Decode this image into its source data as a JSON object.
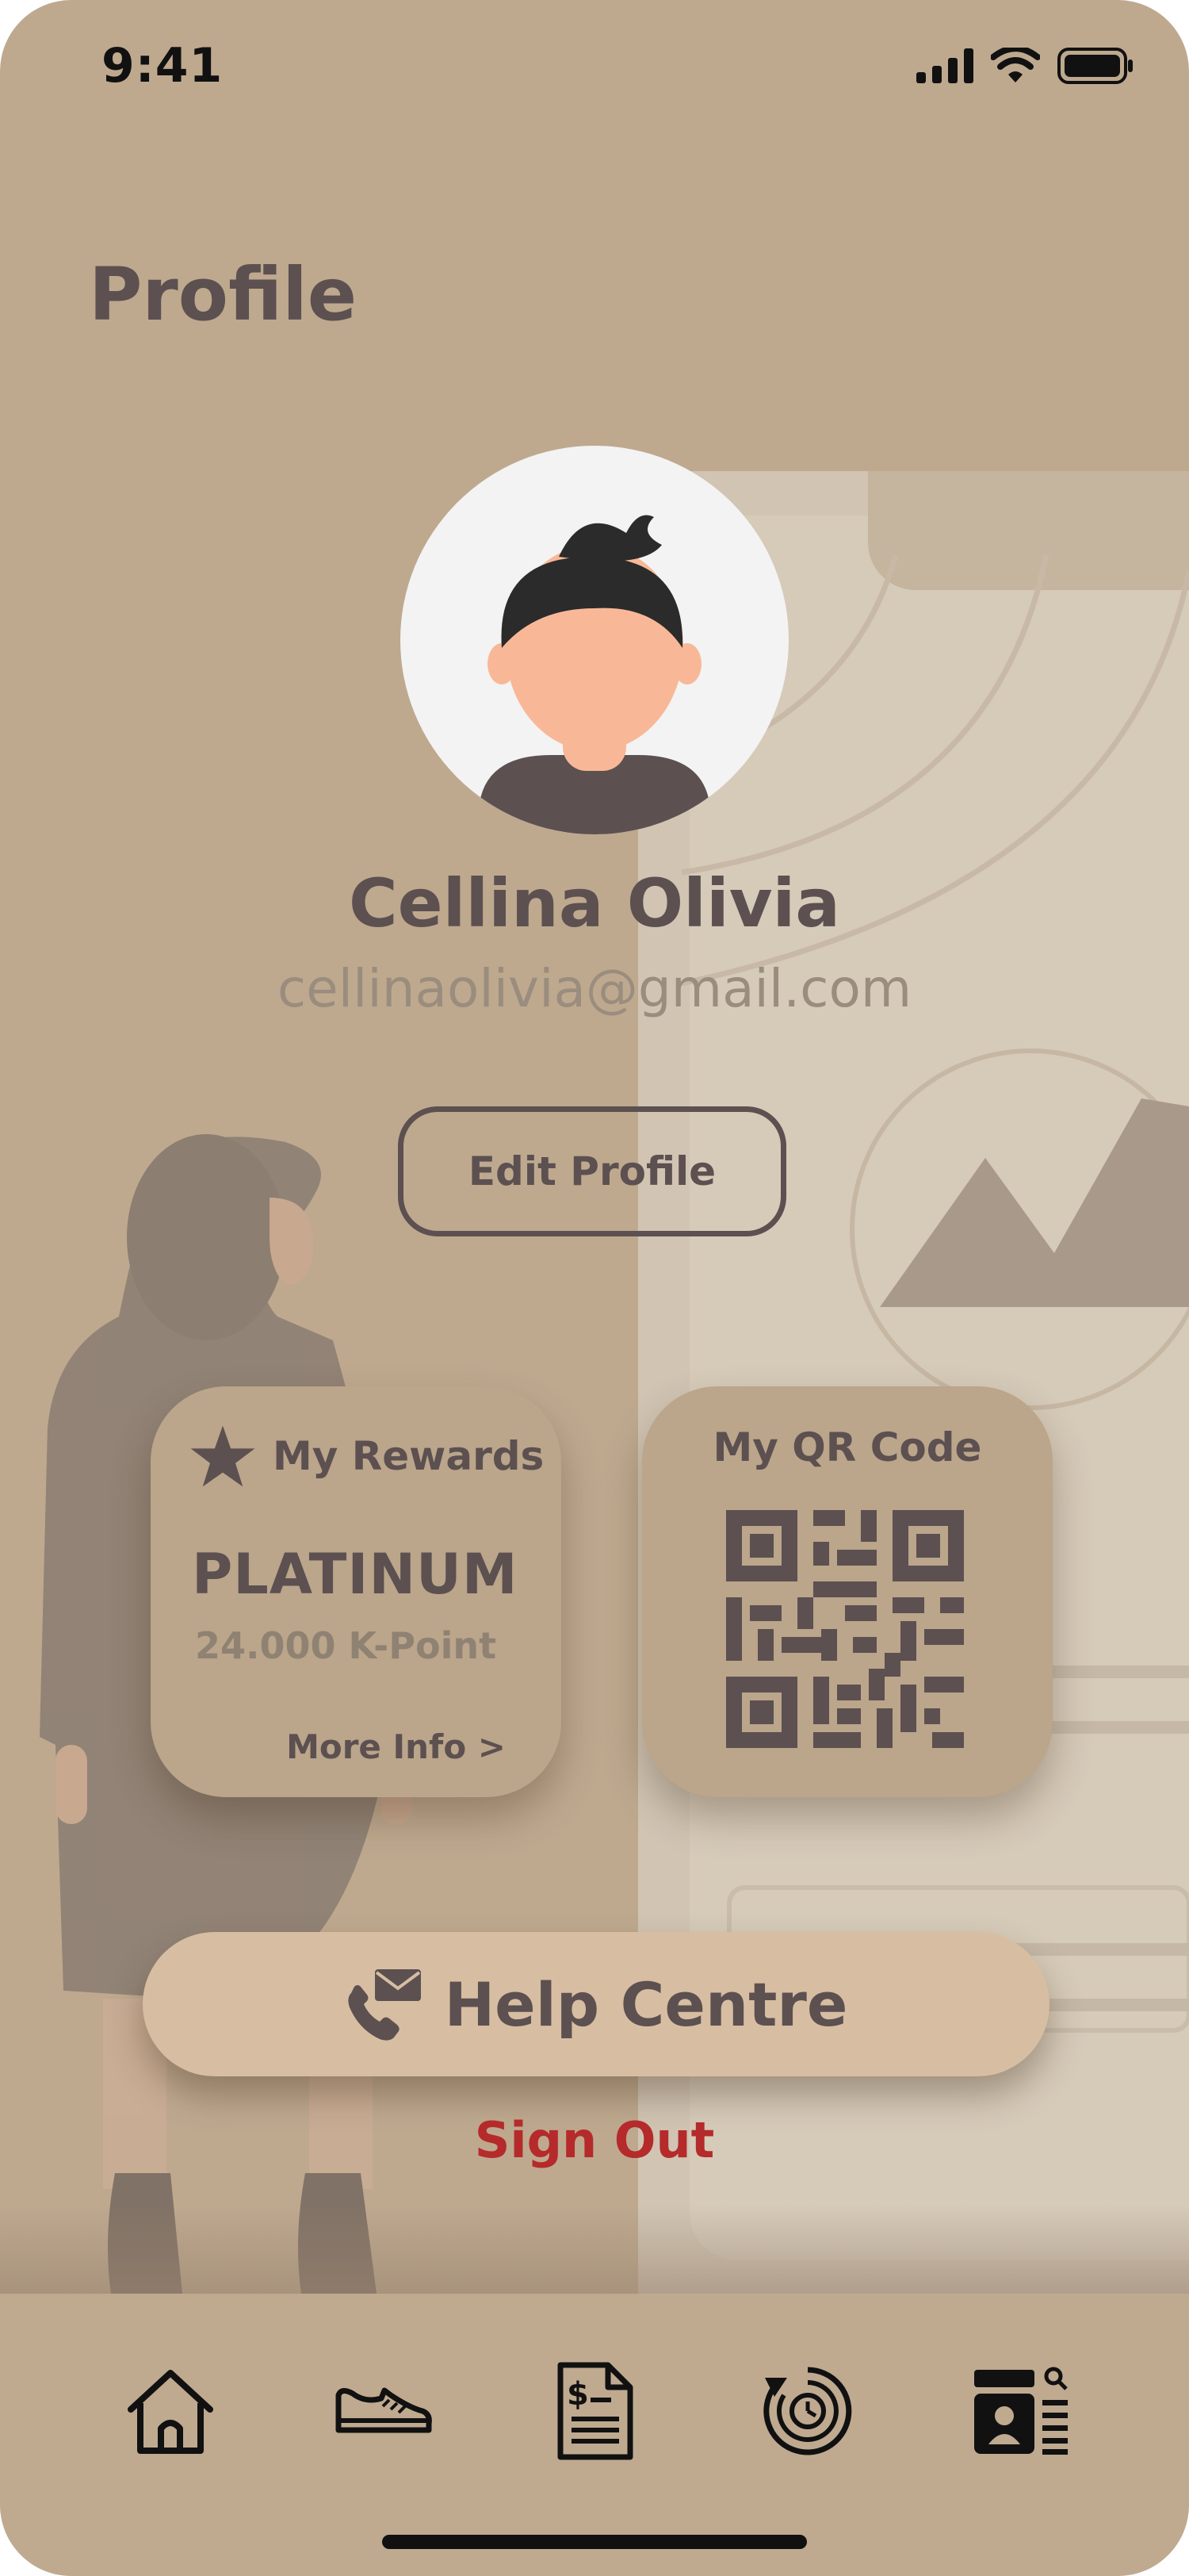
{
  "status_bar": {
    "time": "9:41"
  },
  "page": {
    "title": "Profile"
  },
  "profile": {
    "name": "Cellina Olivia",
    "email": "cellinaolivia@gmail.com",
    "edit_label": "Edit Profile"
  },
  "rewards_card": {
    "title": "My Rewards",
    "tier": "PLATINUM",
    "points": "24.000 K-Point",
    "more_label": "More Info >"
  },
  "qr_card": {
    "title": "My QR Code"
  },
  "help": {
    "label": "Help Centre"
  },
  "signout": {
    "label": "Sign Out"
  },
  "tabbar": {
    "items": [
      "home-icon",
      "shoe-icon",
      "invoice-icon",
      "history-icon",
      "profile-card-icon"
    ]
  },
  "colors": {
    "background": "#bea98f",
    "text_primary": "#5c5050",
    "text_muted": "#9a8d7e",
    "danger": "#b52a2a",
    "help_button": "#d7bea2"
  }
}
